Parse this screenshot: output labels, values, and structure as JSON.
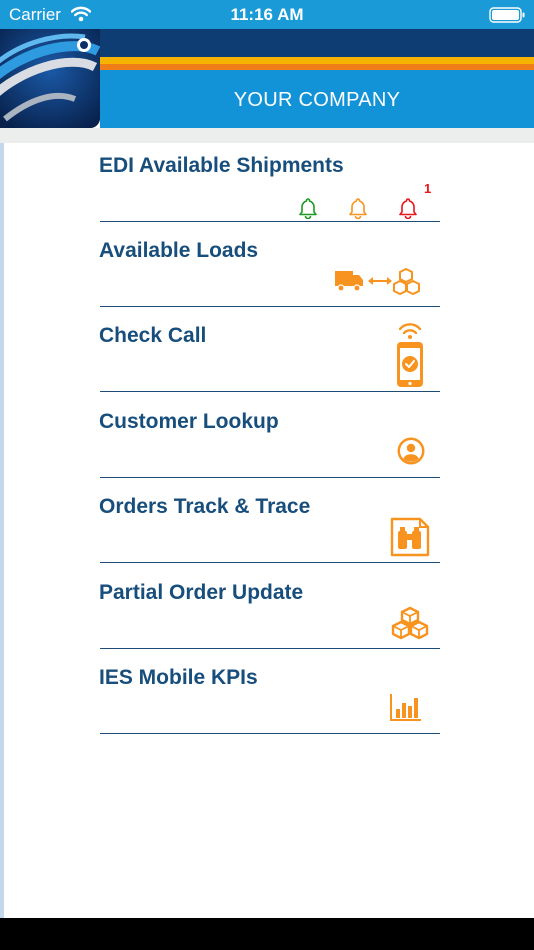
{
  "status_bar": {
    "carrier": "Carrier",
    "time": "11:16 AM"
  },
  "header": {
    "company_name": "YOUR COMPANY",
    "colors": {
      "navy": "#0d3d73",
      "yellow": "#f6b400",
      "orange": "#f07e18",
      "blue": "#1293d8"
    }
  },
  "menu": {
    "items": [
      {
        "label": "EDI Available Shipments",
        "icons": [
          "bell-green-icon",
          "bell-orange-icon",
          "bell-red-icon"
        ],
        "badge": "1"
      },
      {
        "label": "Available Loads",
        "icons": [
          "truck-to-boxes-icon"
        ]
      },
      {
        "label": "Check Call",
        "icons": [
          "phone-wifi-check-icon"
        ]
      },
      {
        "label": "Customer Lookup",
        "icons": [
          "user-circle-icon"
        ]
      },
      {
        "label": "Orders Track & Trace",
        "icons": [
          "binoculars-document-icon"
        ]
      },
      {
        "label": "Partial Order Update",
        "icons": [
          "boxes-icon"
        ]
      },
      {
        "label": "IES Mobile KPIs",
        "icons": [
          "bar-chart-icon"
        ]
      }
    ],
    "colors": {
      "label": "#174e7c",
      "icon": "#f7931e",
      "divider": "#1e4c74"
    }
  }
}
